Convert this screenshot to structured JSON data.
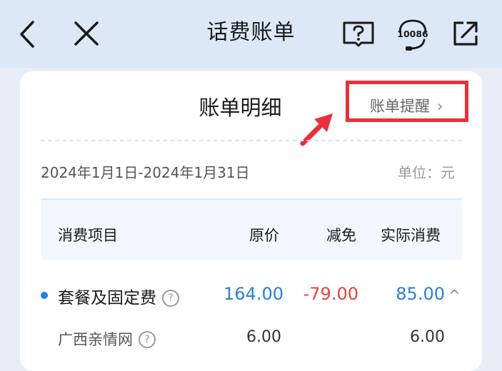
{
  "header": {
    "title": "话费账单",
    "back_icon": "back-chevron-icon",
    "close_icon": "close-icon",
    "help_icon": "help-book-icon",
    "service_number": "10086",
    "share_icon": "share-icon"
  },
  "card": {
    "title": "账单明细",
    "reminder_label": "账单提醒",
    "reminder_chevron": "›",
    "annotation_color": "#e8303c"
  },
  "period": {
    "date_range": "2024年1月1日-2024年1月31日",
    "unit": "单位：元"
  },
  "table": {
    "columns": [
      "消费项目",
      "原价",
      "减免",
      "实际消费"
    ],
    "rows": [
      {
        "name": "套餐及固定费",
        "help": "?",
        "original": "164.00",
        "discount": "-79.00",
        "actual": "85.00",
        "expanded": true,
        "toggle": "^"
      },
      {
        "name": "广西亲情网",
        "help": "?",
        "original": "6.00",
        "discount": "",
        "actual": "6.00"
      }
    ]
  },
  "colors": {
    "header_bg": "#dce8f6",
    "accent_blue": "#2a7fd4",
    "discount_red": "#e4453e"
  }
}
